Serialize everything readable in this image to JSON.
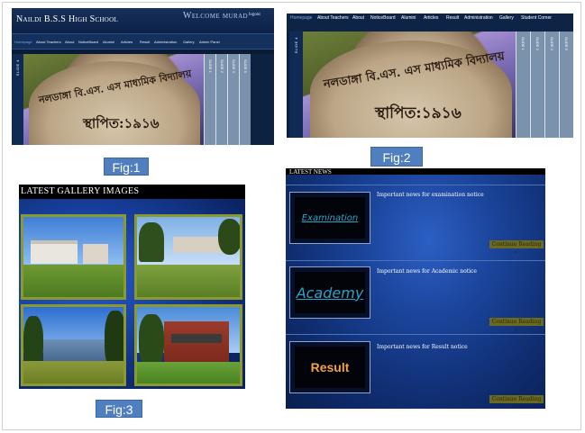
{
  "fig1": {
    "school_name": "Naildi B.S.S High School",
    "welcome": "Welcome murad",
    "logout": "logout",
    "nav": [
      "Homepage",
      "About Teachers",
      "About",
      "NoticeBoard",
      "Alumini",
      "Articles",
      "Result",
      "Administration",
      "Gallery",
      "Admin Panel"
    ],
    "slide_tab": "SLIDE 4",
    "strips": [
      "SLIDE 1",
      "SLIDE 2",
      "SLIDE 3",
      "SLIDE 5"
    ],
    "stone_text_line1": "নলডাঙ্গা বি.এস. এস মাধ্যমিক বিদ্যালয়",
    "stone_text_line2": "স্থাপিত:১৯১৬"
  },
  "fig2": {
    "nav": [
      "Homepage",
      "About Teachers",
      "About",
      "NoticeBoard",
      "Alumini",
      "Articles",
      "Result",
      "Administration",
      "Gallery",
      "Student Corner"
    ],
    "slide_tab": "SLIDE 4",
    "strips": [
      "SLIDE 1",
      "SLIDE 2",
      "SLIDE 3",
      "SLIDE 5"
    ],
    "stone_text_line1": "নলডাঙ্গা বি.এস. এস মাধ্যমিক বিদ্যালয়",
    "stone_text_line2": "স্থাপিত:১৯১৬"
  },
  "fig3": {
    "title": "LATEST GALLERY IMAGES"
  },
  "fig4": {
    "title": "LATEST NEWS",
    "items": [
      {
        "thumb": "Examination",
        "headline": "Important news for examination notice",
        "more": "Continue Reading »"
      },
      {
        "thumb": "Academy",
        "headline": "Important news for Academic notice",
        "more": "Continue Reading »"
      },
      {
        "thumb": "Result",
        "headline": "Important news for Result notice",
        "more": "Continue Reading »"
      }
    ]
  },
  "captions": {
    "fig1": "Fig:1",
    "fig2": "Fig:2",
    "fig3": "Fig:3"
  },
  "colors": {
    "caption_bg": "#4f7fbf",
    "photo_border": "#8c9a2c",
    "continue_bg": "#6b6a23",
    "result_text": "#f3a24a",
    "link_text": "#2aa3c9"
  }
}
